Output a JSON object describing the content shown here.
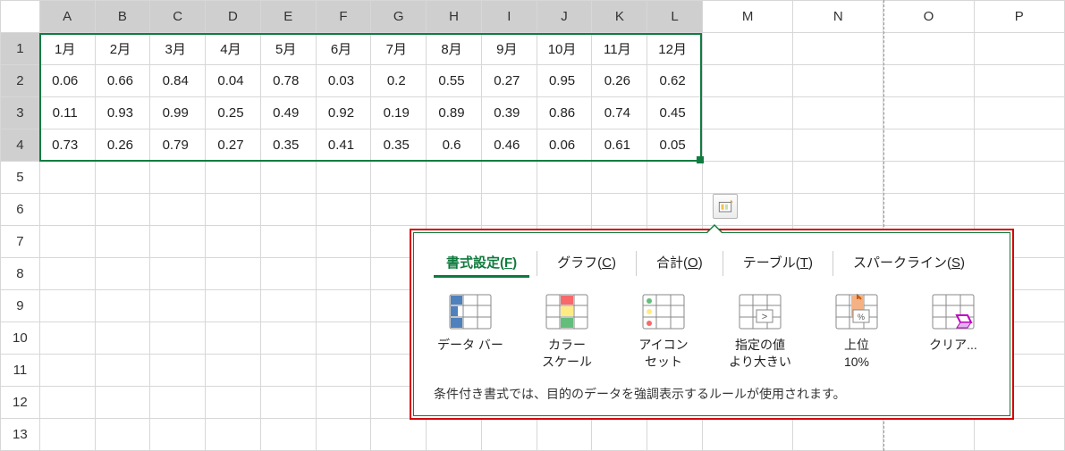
{
  "columns": [
    "A",
    "B",
    "C",
    "D",
    "E",
    "F",
    "G",
    "H",
    "I",
    "J",
    "K",
    "L",
    "M",
    "N",
    "O",
    "P"
  ],
  "rows": [
    1,
    2,
    3,
    4,
    5,
    6,
    7,
    8,
    9,
    10,
    11,
    12,
    13
  ],
  "headerRow": [
    "1月",
    "2月",
    "3月",
    "4月",
    "5月",
    "6月",
    "7月",
    "8月",
    "9月",
    "10月",
    "11月",
    "12月"
  ],
  "dataRows": [
    [
      0.06,
      0.66,
      0.84,
      0.04,
      0.78,
      0.03,
      0.2,
      0.55,
      0.27,
      0.95,
      0.26,
      0.62
    ],
    [
      0.11,
      0.93,
      0.99,
      0.25,
      0.49,
      0.92,
      0.19,
      0.89,
      0.39,
      0.86,
      0.74,
      0.45
    ],
    [
      0.73,
      0.26,
      0.79,
      0.27,
      0.35,
      0.41,
      0.35,
      0.6,
      0.46,
      0.06,
      0.61,
      0.05
    ]
  ],
  "gallery": {
    "tabs": [
      {
        "label": "書式設定",
        "accel": "F"
      },
      {
        "label": "グラフ",
        "accel": "C"
      },
      {
        "label": "合計",
        "accel": "O"
      },
      {
        "label": "テーブル",
        "accel": "T"
      },
      {
        "label": "スパークライン",
        "accel": "S"
      }
    ],
    "items": [
      {
        "label": "データ バー",
        "icon": "databar"
      },
      {
        "label": "カラー\nスケール",
        "icon": "colorscale"
      },
      {
        "label": "アイコン\nセット",
        "icon": "iconset"
      },
      {
        "label": "指定の値\nより大きい",
        "icon": "greater"
      },
      {
        "label": "上位\n10%",
        "icon": "top10"
      },
      {
        "label": "クリア...",
        "icon": "clear"
      }
    ],
    "description": "条件付き書式では、目的のデータを強調表示するルールが使用されます。"
  }
}
